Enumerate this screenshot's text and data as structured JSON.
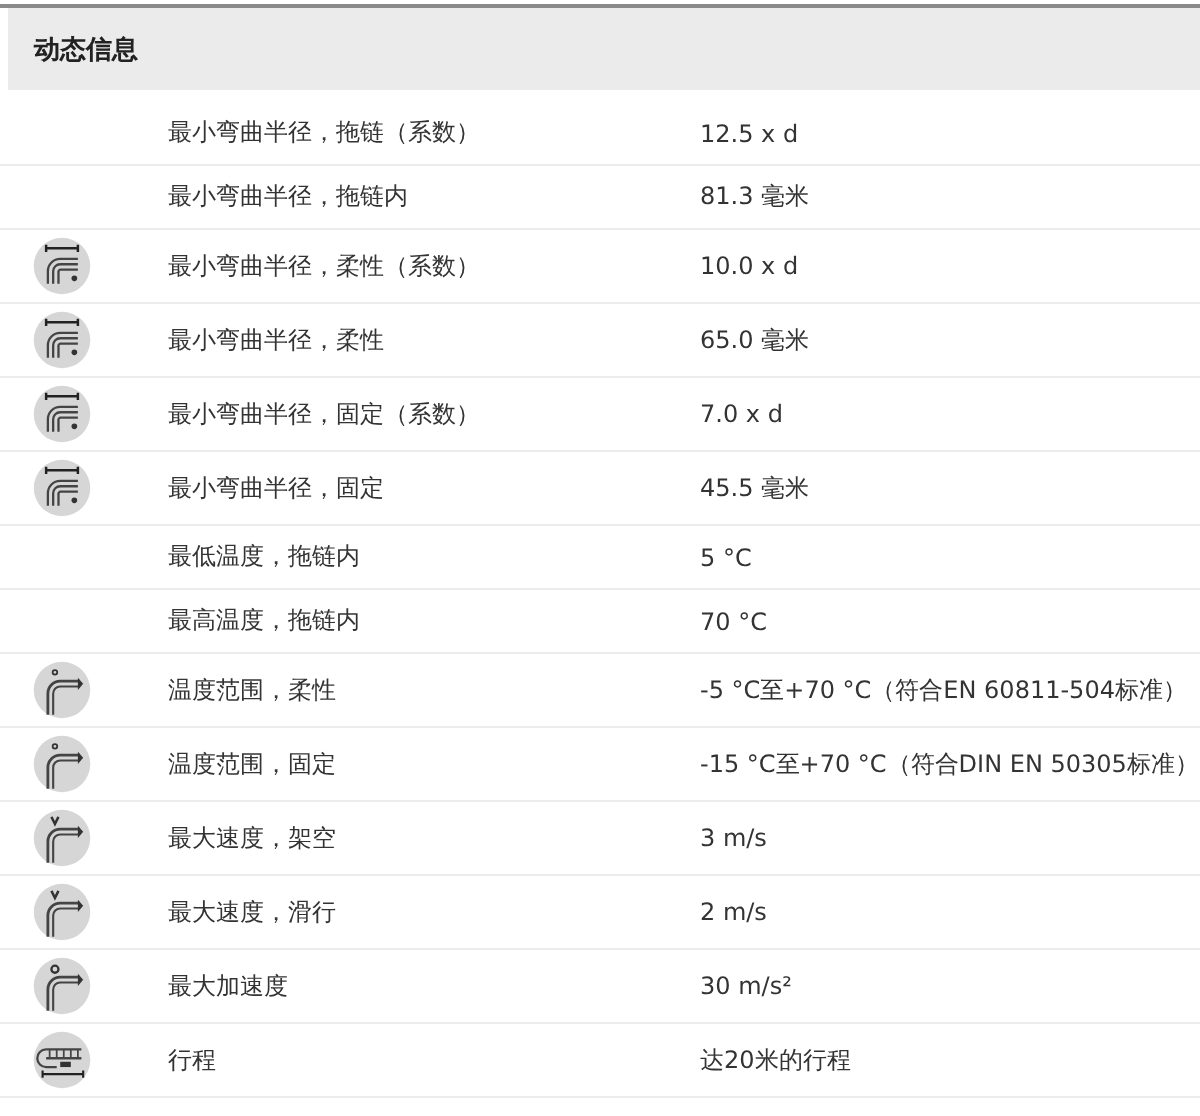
{
  "section": {
    "title": "动态信息"
  },
  "rows": [
    {
      "kind": "plain",
      "label": "最小弯曲半径，拖链（系数）",
      "value": "12.5 x d"
    },
    {
      "kind": "plain",
      "label": "最小弯曲半径，拖链内",
      "value": "81.3 毫米"
    },
    {
      "kind": "bend",
      "label": "最小弯曲半径，柔性（系数）",
      "value": "10.0 x d"
    },
    {
      "kind": "bend",
      "label": "最小弯曲半径，柔性",
      "value": "65.0 毫米"
    },
    {
      "kind": "bend",
      "label": "最小弯曲半径，固定（系数）",
      "value": "7.0 x d"
    },
    {
      "kind": "bend",
      "label": "最小弯曲半径，固定",
      "value": "45.5 毫米"
    },
    {
      "kind": "plain",
      "label": "最低温度，拖链内",
      "value": "5 °C"
    },
    {
      "kind": "plain",
      "label": "最高温度，拖链内",
      "value": "70 °C"
    },
    {
      "kind": "temperature",
      "label": "温度范围，柔性",
      "value": "-5 °C至+70 °C（符合EN 60811-504标准）"
    },
    {
      "kind": "temperature",
      "label": "温度范围，固定",
      "value": "-15 °C至+70 °C（符合DIN EN 50305标准）"
    },
    {
      "kind": "speed",
      "label": "最大速度，架空",
      "value": "3 m/s"
    },
    {
      "kind": "speed",
      "label": "最大速度，滑行",
      "value": "2 m/s"
    },
    {
      "kind": "acceleration",
      "label": "最大加速度",
      "value": "30 m/s²"
    },
    {
      "kind": "travel",
      "label": "行程",
      "value": "达20米的行程"
    }
  ]
}
